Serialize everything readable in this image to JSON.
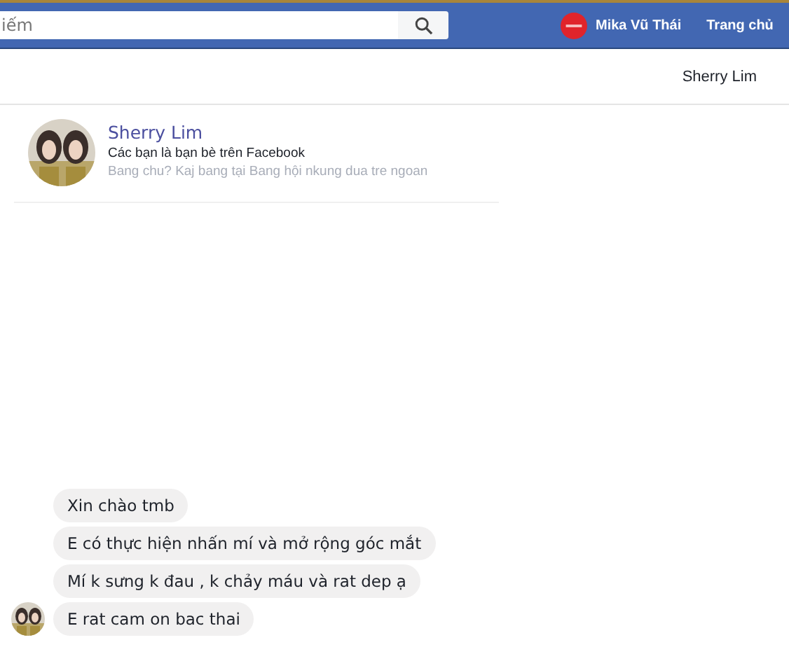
{
  "top_bar": {
    "search": {
      "placeholder": "iếm"
    },
    "user_name": "Mika Vũ Thái",
    "home_link": "Trang chủ"
  },
  "conversation_header": {
    "title": "Sherry Lim"
  },
  "profile": {
    "name": "Sherry Lim",
    "friend_note": "Các bạn là bạn bè trên Facebook",
    "bio": "Bang chu? Kaj bang tại Bang hội nkung dua tre ngoan"
  },
  "messages": [
    {
      "text": "Xin chào tmb"
    },
    {
      "text": "E có thực hiện nhấn mí và mở rộng góc mắt"
    },
    {
      "text": "Mí k sưng k đau , k chảy máu và rat dep ạ"
    },
    {
      "text": "E rat cam on bac thai"
    }
  ]
}
